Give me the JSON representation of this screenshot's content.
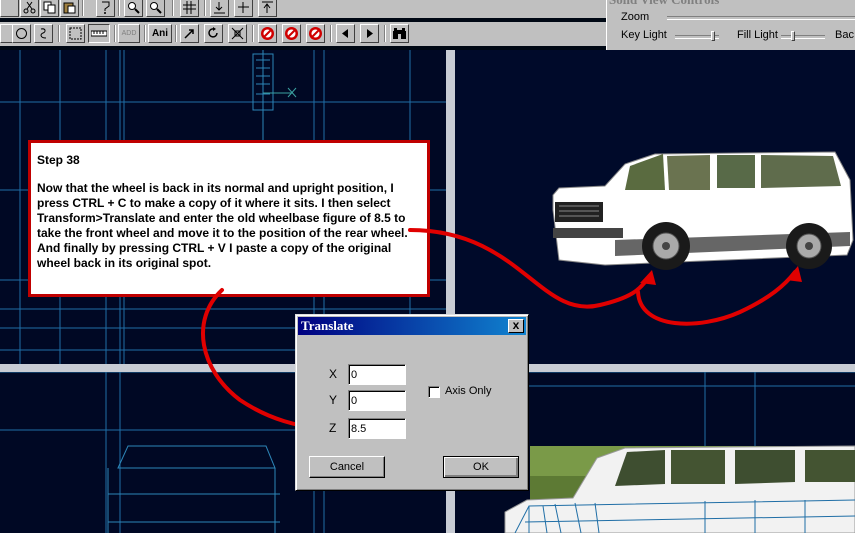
{
  "toolbar": {
    "tool_icons": [
      "scissors-icon",
      "copy-icon",
      "paste-icon",
      "help-icon",
      "zoom-icon",
      "zoom-icon",
      "grid-icon",
      "align-icon",
      "align-icon",
      "align-icon"
    ],
    "add_label": "ADD",
    "ani_label": "Ani"
  },
  "solid_view_controls": {
    "title": "Solid View Controls",
    "zoom_label": "Zoom",
    "key_light_label": "Key Light",
    "fill_light_label": "Fill Light",
    "back_light_label": "Bac"
  },
  "note": {
    "title": "Step 38",
    "body": "Now that the wheel is back in its normal and upright position, I press CTRL + C to make a copy of it where it sits. I then select Transform>Translate and enter the old wheelbase figure of 8.5 to take the front wheel and move it to the position of the rear wheel. And finally by pressing CTRL + V I paste a copy of the original wheel back in its original spot."
  },
  "dialog": {
    "title": "Translate",
    "close_label": "x",
    "x_label": "X",
    "x_value": "0",
    "y_label": "Y",
    "y_value": "0",
    "z_label": "Z",
    "z_value": "8.5",
    "axis_only_label": "Axis Only",
    "cancel_label": "Cancel",
    "ok_label": "OK"
  },
  "colors": {
    "viewport_bg": "#000824",
    "wire": "#1a6ea8",
    "annotation_red": "#e00000",
    "window_gray": "#c0c0c0",
    "titlebar": "#000080"
  }
}
